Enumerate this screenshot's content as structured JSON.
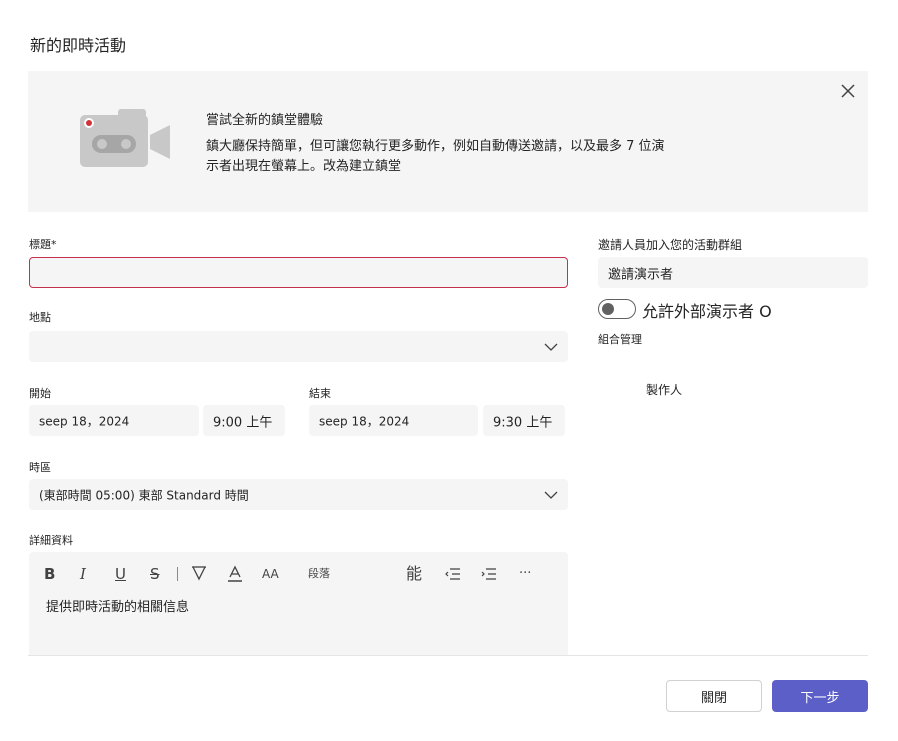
{
  "dialog": {
    "title": "新的即時活動"
  },
  "banner": {
    "heading": "嘗試全新的鎮堂體驗",
    "body": "鎮大廳保持簡單，但可讓您執行更多動作，例如自動傳送邀請，以及最多 7 位演示者出現在螢幕上。改為建立鎮堂"
  },
  "form": {
    "title_label": "標題*",
    "title_value": "",
    "location_label": "地點",
    "location_value": "",
    "start_label": "開始",
    "start_date": "seep 18，2024",
    "start_time": "9:00 上午",
    "end_label": "結束",
    "end_date": "seep 18，2024",
    "end_time": "9:30 上午",
    "timezone_label": "時區",
    "timezone_value": "(東部時間 05:00) 東部 Standard 時間",
    "details_label": "詳細資料",
    "details_placeholder": "提供即時活動的相關信息"
  },
  "toolbar": {
    "bold": "B",
    "italic": "I",
    "underline": "U",
    "strike": "S",
    "font_size": "AA",
    "paragraph": "段落",
    "format": "能",
    "more": "···"
  },
  "side": {
    "invite_label": "邀請人員加入您的活動群組",
    "invite_placeholder": "邀請演示者",
    "external_toggle_label": "允許外部演示者 O",
    "org_label": "組合管理",
    "organizer": "製作人"
  },
  "buttons": {
    "close": "關閉",
    "next": "下一步"
  },
  "colors": {
    "accent": "#5b5fc7",
    "error_border": "#c4314b",
    "field_bg": "#f5f5f5"
  }
}
